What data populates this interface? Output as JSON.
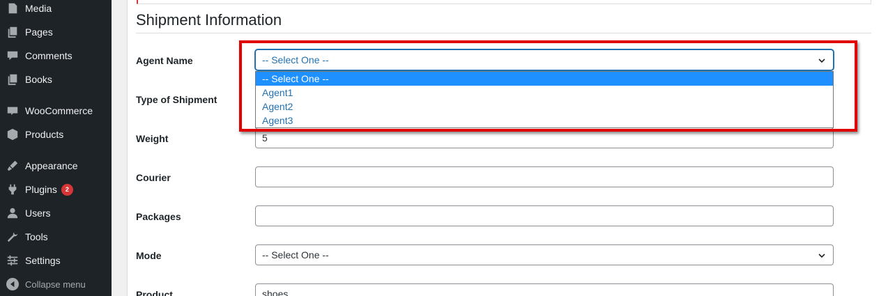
{
  "sidebar": {
    "items": [
      {
        "label": "Media",
        "icon": "media-icon"
      },
      {
        "label": "Pages",
        "icon": "pages-icon"
      },
      {
        "label": "Comments",
        "icon": "comments-icon"
      },
      {
        "label": "Books",
        "icon": "books-icon"
      },
      {
        "label": "WooCommerce",
        "icon": "woocommerce-icon"
      },
      {
        "label": "Products",
        "icon": "products-icon"
      },
      {
        "label": "Appearance",
        "icon": "appearance-icon"
      },
      {
        "label": "Plugins",
        "icon": "plugins-icon",
        "badge": "2"
      },
      {
        "label": "Users",
        "icon": "users-icon"
      },
      {
        "label": "Tools",
        "icon": "tools-icon"
      },
      {
        "label": "Settings",
        "icon": "settings-icon"
      }
    ],
    "collapse_label": "Collapse menu"
  },
  "section": {
    "title": "Shipment Information"
  },
  "form": {
    "agent_name": {
      "label": "Agent Name",
      "value": "-- Select One --",
      "options": [
        "-- Select One --",
        "Agent1",
        "Agent2",
        "Agent3"
      ],
      "selected_option": "-- Select One --"
    },
    "type_of_shipment": {
      "label": "Type of Shipment"
    },
    "weight": {
      "label": "Weight",
      "value": "5"
    },
    "courier": {
      "label": "Courier",
      "value": ""
    },
    "packages": {
      "label": "Packages",
      "value": ""
    },
    "mode": {
      "label": "Mode",
      "value": "-- Select One --"
    },
    "product": {
      "label": "Product",
      "value": "shoes"
    }
  },
  "colors": {
    "sidebar_bg": "#1d2327",
    "accent": "#2271b1",
    "highlight": "#e00000",
    "badge": "#d63638",
    "selected_option_bg": "#1e90ff"
  }
}
